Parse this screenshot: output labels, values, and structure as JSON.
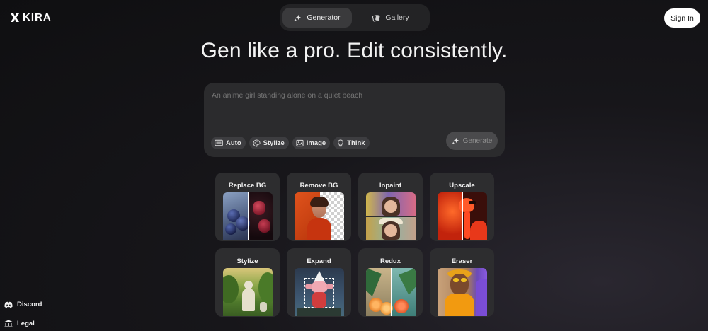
{
  "brand": {
    "name": "KIRA"
  },
  "nav": {
    "tabs": [
      {
        "label": "Generator",
        "icon": "sparkle-icon",
        "active": true
      },
      {
        "label": "Gallery",
        "icon": "cards-icon",
        "active": false
      }
    ],
    "sign_in": "Sign In"
  },
  "hero": {
    "title": "Gen like a pro. Edit consistently."
  },
  "prompt": {
    "placeholder": "An anime girl standing alone on a quiet beach",
    "chips": [
      {
        "label": "Auto",
        "icon": "ratio-icon"
      },
      {
        "label": "Stylize",
        "icon": "palette-icon"
      },
      {
        "label": "Image",
        "icon": "image-icon"
      },
      {
        "label": "Think",
        "icon": "bulb-icon"
      }
    ],
    "generate": "Generate"
  },
  "tools": [
    {
      "label": "Replace BG"
    },
    {
      "label": "Remove BG"
    },
    {
      "label": "Inpaint"
    },
    {
      "label": "Upscale"
    },
    {
      "label": "Stylize"
    },
    {
      "label": "Expand"
    },
    {
      "label": "Redux"
    },
    {
      "label": "Eraser"
    }
  ],
  "sidebar": {
    "discord": "Discord",
    "legal": "Legal"
  }
}
